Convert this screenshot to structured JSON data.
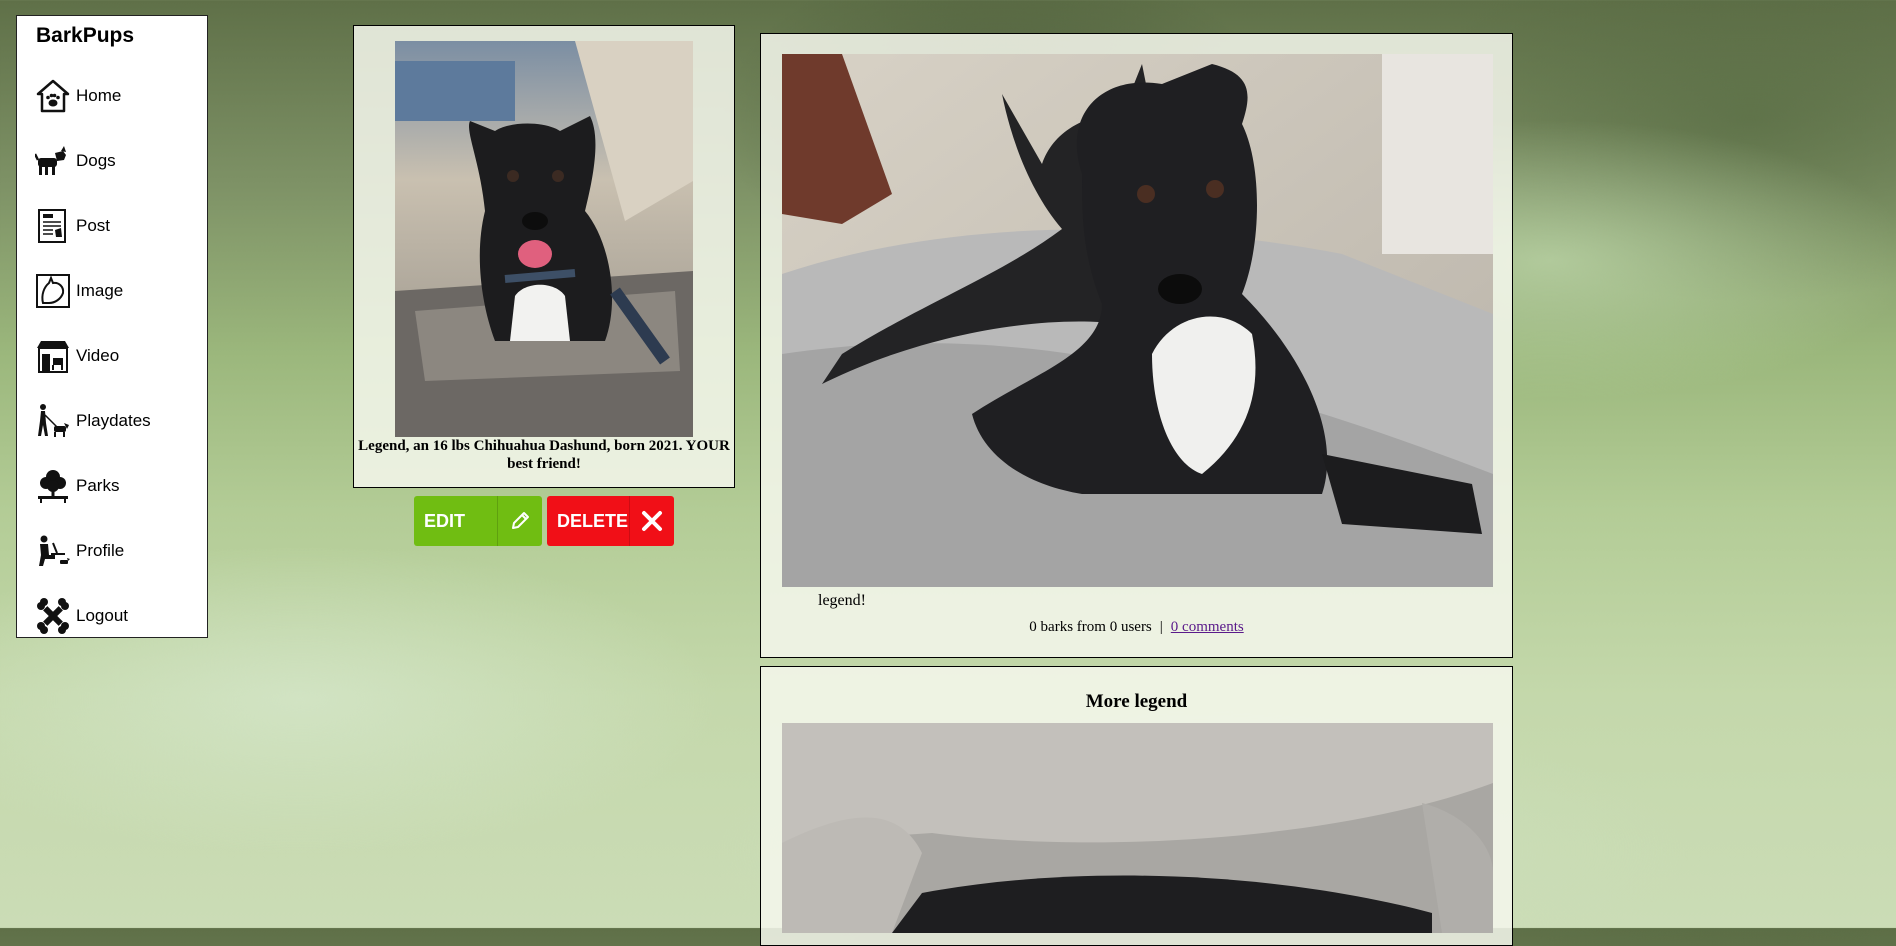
{
  "sidebar": {
    "brand": "BarkPups",
    "items": [
      {
        "label": "Home",
        "icon": "house-paw-icon"
      },
      {
        "label": "Dogs",
        "icon": "dog-icon"
      },
      {
        "label": "Post",
        "icon": "post-icon"
      },
      {
        "label": "Image",
        "icon": "dog-portrait-icon"
      },
      {
        "label": "Video",
        "icon": "storefront-dog-icon"
      },
      {
        "label": "Playdates",
        "icon": "person-walking-dog-icon"
      },
      {
        "label": "Parks",
        "icon": "tree-bench-icon"
      },
      {
        "label": "Profile",
        "icon": "person-laptop-dog-icon"
      },
      {
        "label": "Logout",
        "icon": "bones-icon"
      }
    ]
  },
  "profile": {
    "caption": "Legend, an 16 lbs Chihuahua Dashund, born 2021. YOUR best friend!"
  },
  "actions": {
    "edit_label": "EDIT",
    "delete_label": "DELETE"
  },
  "post": {
    "text": "legend!",
    "barks": "0 barks from 0 users",
    "separator": "|",
    "comments": "0 comments"
  },
  "post2": {
    "title": "More legend"
  },
  "colors": {
    "edit": "#70bd12",
    "delete": "#f10f17",
    "link": "#5a1a8a"
  }
}
